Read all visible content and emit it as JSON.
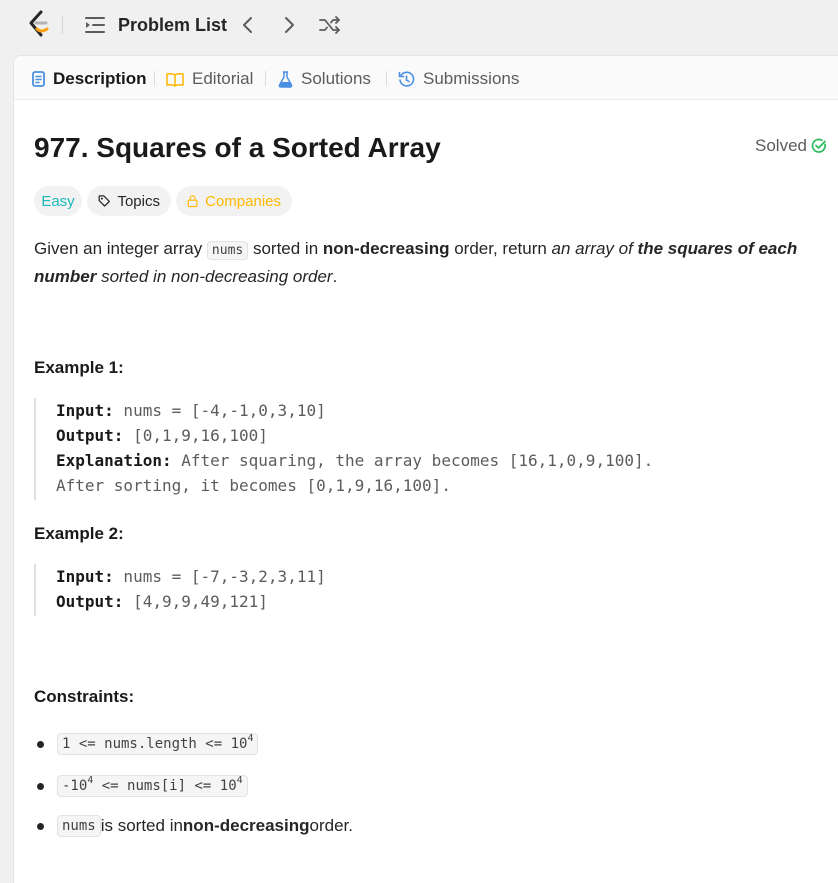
{
  "nav": {
    "problem_list_label": "Problem List",
    "icons": [
      "logo-icon",
      "list-icon",
      "chevron-left-icon",
      "chevron-right-icon",
      "shuffle-icon"
    ]
  },
  "tabs": [
    {
      "label": "Description",
      "icon": "document-icon",
      "active": true
    },
    {
      "label": "Editorial",
      "icon": "book-icon",
      "active": false
    },
    {
      "label": "Solutions",
      "icon": "flask-icon",
      "active": false
    },
    {
      "label": "Submissions",
      "icon": "history-icon",
      "active": false
    }
  ],
  "problem": {
    "title": "977. Squares of a Sorted Array",
    "status": "Solved",
    "difficulty": "Easy",
    "topics_label": "Topics",
    "companies_label": "Companies",
    "description": {
      "t1": "Given an integer array ",
      "code": "nums",
      "t2": " sorted in ",
      "b1": "non-decreasing",
      "t3": " order, return ",
      "i1": "an array of ",
      "bi1": "the squares of each number",
      "i2": " sorted in non-decreasing order",
      "t4": "."
    }
  },
  "examples": [
    {
      "heading": "Example 1:",
      "input_label": "Input:",
      "input": " nums = [-4,-1,0,3,10]",
      "output_label": "Output:",
      "output": " [0,1,9,16,100]",
      "explanation_label": "Explanation:",
      "explanation_line1": " After squaring, the array becomes [16,1,0,9,100].",
      "explanation_line2": "After sorting, it becomes [0,1,9,16,100]."
    },
    {
      "heading": "Example 2:",
      "input_label": "Input:",
      "input": " nums = [-7,-3,2,3,11]",
      "output_label": "Output:",
      "output": " [4,9,9,49,121]"
    }
  ],
  "constraints": {
    "heading": "Constraints:",
    "c1": {
      "pre": "1 <= nums.length <= 10",
      "sup": "4"
    },
    "c2": {
      "pre": "-10",
      "sup1": "4",
      "mid": " <= nums[i] <= 10",
      "sup2": "4"
    },
    "c3": {
      "code": "nums",
      "t1": " is sorted in ",
      "b1": "non-decreasing",
      "t2": " order."
    }
  },
  "colors": {
    "easy": "#1cb8b8",
    "companies": "#ffb800",
    "solved_check": "#2cbb5d",
    "editorial_icon": "#ffb800",
    "solutions_icon": "#4a90e2",
    "submissions_icon": "#4a90e2"
  }
}
